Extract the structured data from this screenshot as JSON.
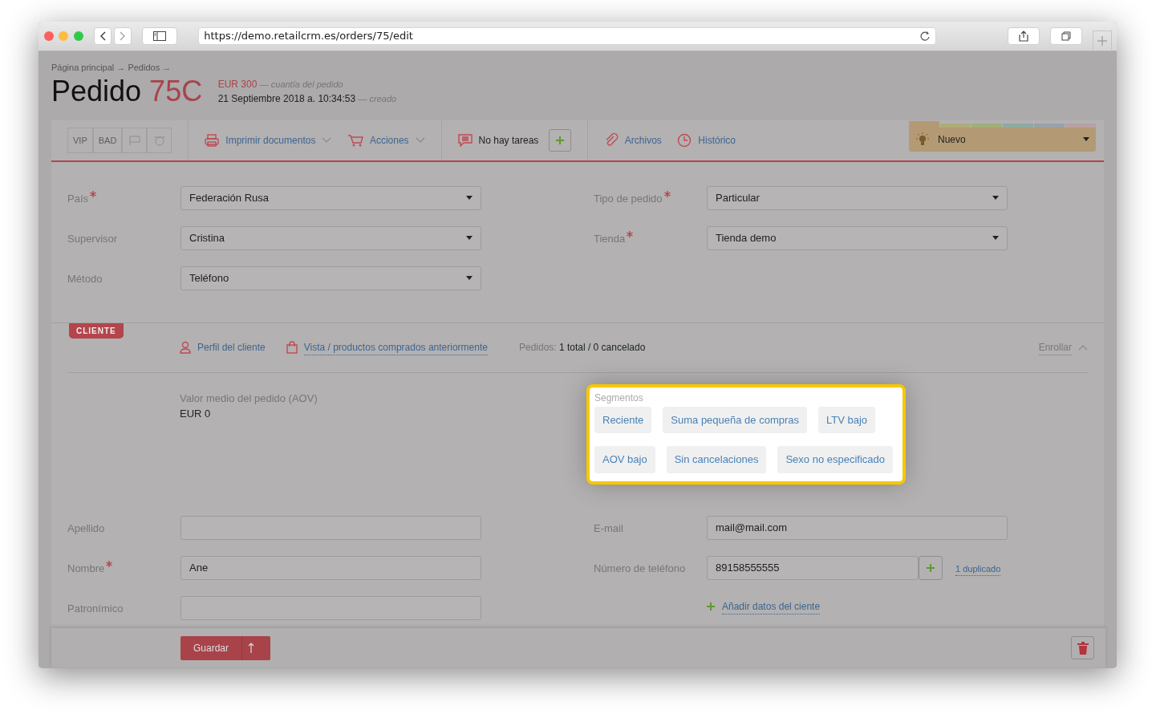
{
  "browser": {
    "url": "https://demo.retailcrm.es/orders/75/edit"
  },
  "breadcrumbs": "Página principal → Pedidos →",
  "title": {
    "prefix": "Pedido",
    "number": "75C"
  },
  "summary": [
    {
      "kind": "amount",
      "value": "EUR 300",
      "note": "— cuantía del pedido"
    },
    {
      "kind": "date",
      "value": "21 Septiembre 2018 a. 10:34:53",
      "note": "— creado"
    }
  ],
  "flags": [
    {
      "kind": "text",
      "label": "VIP"
    },
    {
      "kind": "text",
      "label": "BAD"
    },
    {
      "kind": "flag"
    },
    {
      "kind": "alarm"
    }
  ],
  "toolbar": [
    {
      "kind": "menu",
      "label": "Imprimir documentos"
    },
    {
      "kind": "menu",
      "label": "Acciones"
    },
    {
      "kind": "tasks",
      "label": "No hay tareas"
    },
    {
      "kind": "link",
      "label": "Archivos"
    },
    {
      "kind": "link",
      "label": "Histórico"
    }
  ],
  "status": {
    "label": "Nuevo",
    "stages": [
      {
        "color": "#b39a74",
        "selected": true
      },
      {
        "color": "#aeac78",
        "selected": false
      },
      {
        "color": "#9fae7a",
        "selected": false
      },
      {
        "color": "#8fa9a0",
        "selected": false
      },
      {
        "color": "#98a3a8",
        "selected": false
      },
      {
        "color": "#b8a0a3",
        "selected": false
      }
    ]
  },
  "order_fields": {
    "left": [
      {
        "label": "País",
        "required": true,
        "value": "Federación Rusa"
      },
      {
        "label": "Supervisor",
        "required": false,
        "value": "Cristina"
      },
      {
        "label": "Método",
        "required": false,
        "value": "Teléfono"
      }
    ],
    "right": [
      {
        "label": "Tipo de pedido",
        "required": true,
        "value": "Particular"
      },
      {
        "label": "Tienda",
        "required": true,
        "value": "Tienda demo"
      }
    ]
  },
  "client": {
    "tag": "CLIENTE",
    "links": [
      {
        "label": "Perfil del cliente",
        "dotted": false
      },
      {
        "label": "Vista / productos comprados anteriormente",
        "dotted": true
      }
    ],
    "orders_label": "Pedidos:",
    "orders_value": "1 total / 0 cancelado",
    "collapse": "Enrollar",
    "aov_label": "Valor medio del pedido (AOV)",
    "aov_value": "EUR 0",
    "segments": {
      "title": "Segmentos",
      "items": [
        "Reciente",
        "Suma pequeña de compras",
        "LTV bajo",
        "AOV bajo",
        "Sin cancelaciones",
        "Sexo no especificado"
      ]
    }
  },
  "client_fields": {
    "left": [
      {
        "label": "Apellido",
        "required": false
      },
      {
        "label": "Nombre",
        "required": true,
        "value": "Ane"
      },
      {
        "label": "Patronímico",
        "required": false
      }
    ],
    "right": [
      {
        "label": "E-mail",
        "required": false,
        "value": "mail@mail.com"
      },
      {
        "label": "Número de teléfono",
        "required": false,
        "value": "89158555555",
        "duplicate": "1 duplicado"
      }
    ],
    "add_link": "Añadir datos del ciente"
  },
  "footer": {
    "save": "Guardar"
  }
}
